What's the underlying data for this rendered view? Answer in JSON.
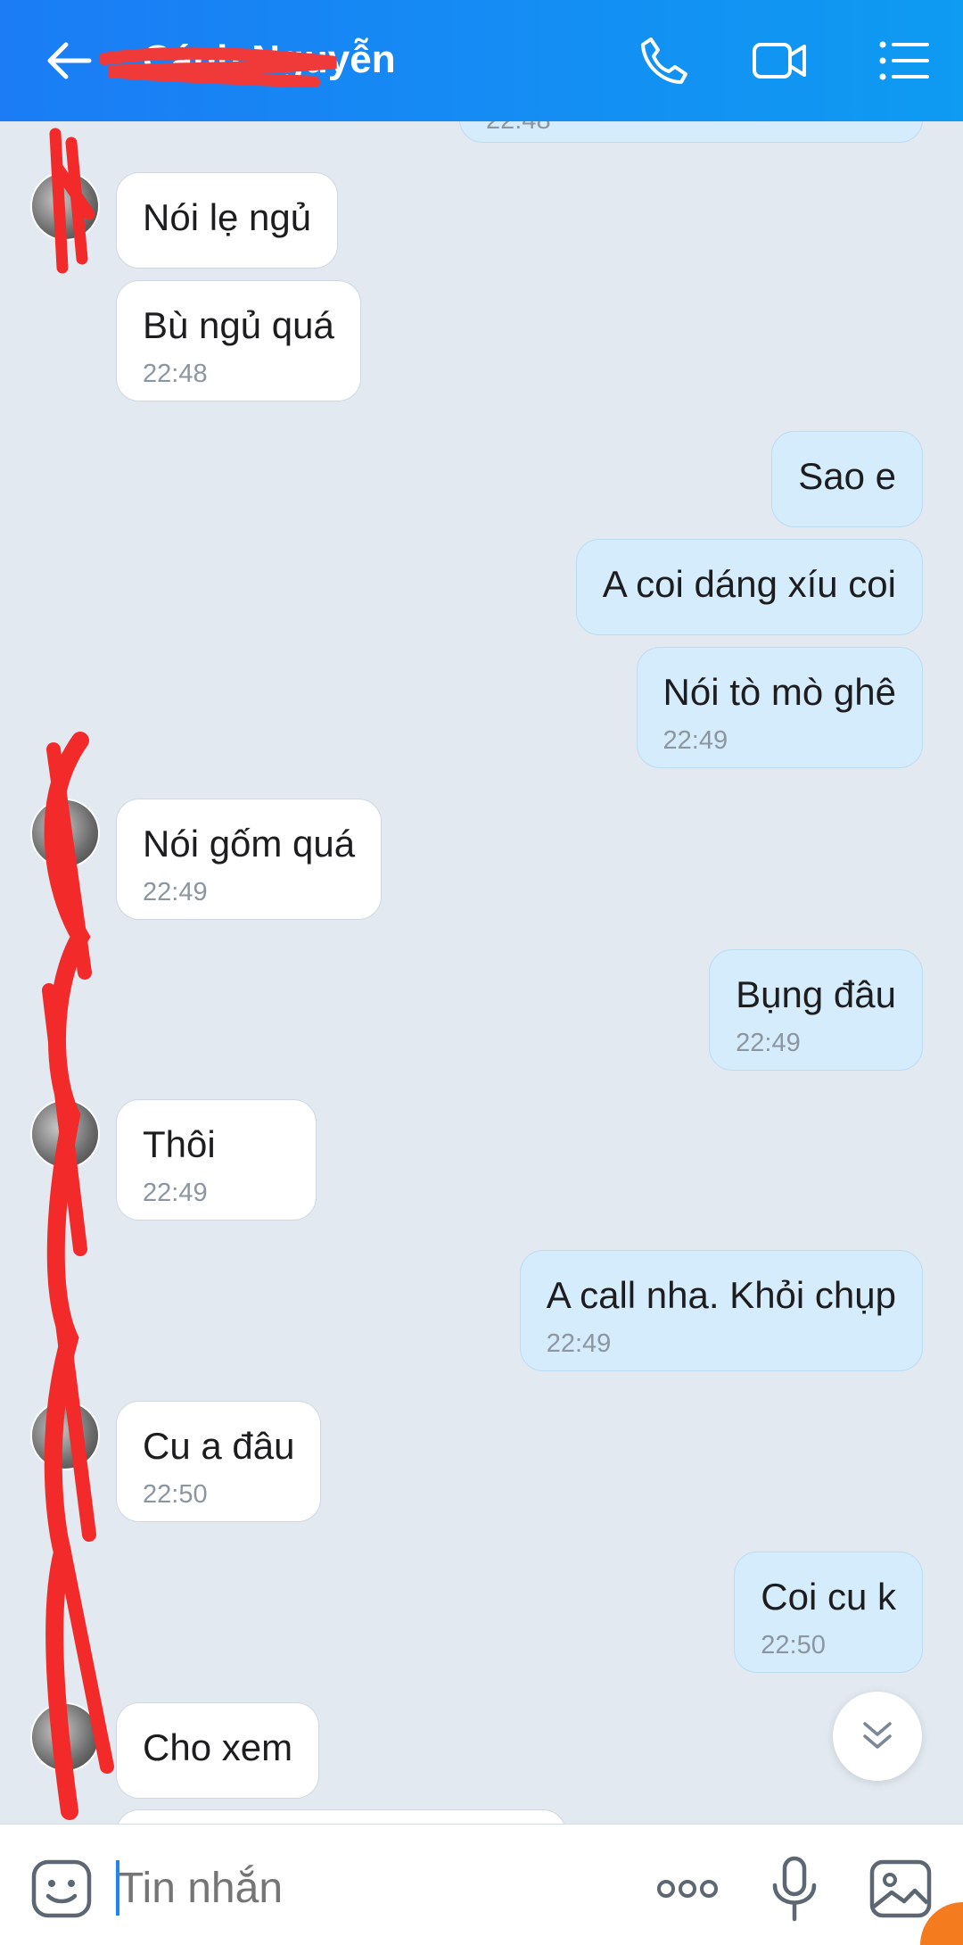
{
  "header": {
    "title": "Cánh Nguyễn",
    "icons": [
      "back-arrow-icon",
      "phone-icon",
      "video-call-icon",
      "menu-list-icon"
    ]
  },
  "partial_top": {
    "time": "22:48"
  },
  "messages": [
    {
      "dir": "in",
      "text": "Nói lẹ ngủ",
      "time": ""
    },
    {
      "dir": "in",
      "text": "Bù ngủ quá",
      "time": "22:48"
    },
    {
      "dir": "out",
      "text": "Sao e",
      "time": ""
    },
    {
      "dir": "out",
      "text": "A coi dáng xíu coi",
      "time": ""
    },
    {
      "dir": "out",
      "text": "Nói tò mò ghê",
      "time": "22:49"
    },
    {
      "dir": "in",
      "text": "Nói gốm quá",
      "time": "22:49"
    },
    {
      "dir": "out",
      "text": "Bụng đâu",
      "time": "22:49"
    },
    {
      "dir": "in",
      "text": "Thôi",
      "time": "22:49"
    },
    {
      "dir": "out",
      "text": "A call nha. Khỏi chụp",
      "time": "22:49"
    },
    {
      "dir": "in",
      "text": "Cu a đâu",
      "time": "22:50"
    },
    {
      "dir": "out",
      "text": "Coi cu k",
      "time": "22:50"
    },
    {
      "dir": "in",
      "text": "Cho xem",
      "time": ""
    }
  ],
  "composer": {
    "placeholder": "Tin nhắn",
    "icons": [
      "emoji-sticker-icon",
      "more-options-icon",
      "microphone-icon",
      "image-gallery-icon"
    ]
  },
  "scroll_down_icon": "double-chevron-down-icon",
  "colors": {
    "header": "#1b7cf5",
    "outgoing_bubble": "#d4ecfc",
    "incoming_bubble": "#ffffff",
    "background": "#e2e9f1"
  }
}
